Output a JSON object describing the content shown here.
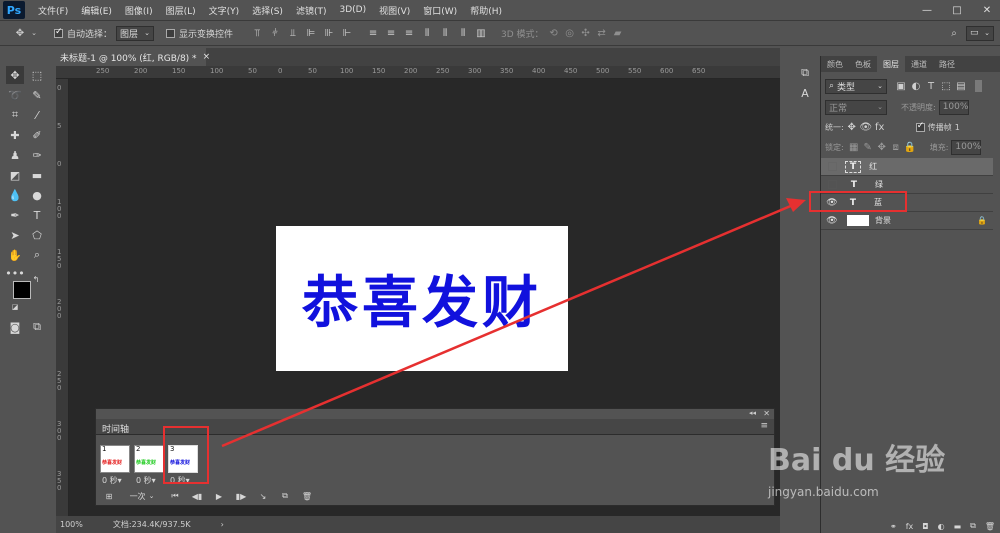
{
  "app": {
    "logo": "Ps"
  },
  "menu": [
    "文件(F)",
    "编辑(E)",
    "图像(I)",
    "图层(L)",
    "文字(Y)",
    "选择(S)",
    "滤镜(T)",
    "3D(D)",
    "视图(V)",
    "窗口(W)",
    "帮助(H)"
  ],
  "window_controls": {
    "minimize": "—",
    "maximize": "□",
    "close": "✕"
  },
  "options": {
    "auto_select_label": "自动选择：",
    "auto_select_value": "图层",
    "show_transform_label": "显示变换控件",
    "mode_3d_label": "3D 模式："
  },
  "document": {
    "tab_title": "未标题-1 @ 100% (红, RGB/8) *",
    "tab_close": "×",
    "canvas_text": "恭喜发财",
    "canvas_text_color": "#1111dd"
  },
  "ruler_top": [
    "250",
    "200",
    "150",
    "100",
    "50",
    "0",
    "50",
    "100",
    "150",
    "200",
    "250",
    "300",
    "350",
    "400",
    "450",
    "500",
    "550",
    "600",
    "650"
  ],
  "ruler_left": [
    "0",
    "5",
    "0",
    "1 0 0",
    "1 5 0",
    "2 0 0",
    "2 5 0",
    "3 0 0",
    "3 5 0"
  ],
  "timeline": {
    "title": "时间轴",
    "frames": [
      {
        "num": "1",
        "text": "恭喜发财",
        "text_color": "#e52222",
        "delay": "0 秒▾"
      },
      {
        "num": "2",
        "text": "恭喜发财",
        "text_color": "#22cc22",
        "delay": "0 秒▾"
      },
      {
        "num": "3",
        "text": "恭喜发财",
        "text_color": "#1111dd",
        "delay": "0 秒▾"
      }
    ],
    "loop_value": "一次"
  },
  "status": {
    "zoom": "100%",
    "doc_info": "文档:234.4K/937.5K"
  },
  "panel": {
    "tabs": [
      "颜色",
      "色板",
      "图层",
      "通道",
      "路径"
    ],
    "active_tab": "图层",
    "filter_kind": "类型",
    "blend_mode": "正常",
    "opacity_label": "不透明度:",
    "opacity_value": "100%",
    "unify_label": "统一:",
    "propagate_label": "传播帧",
    "propagate_value": "1",
    "lock_label": "锁定:",
    "fill_label": "填充:",
    "fill_value": "100%",
    "layers": [
      {
        "name": "红",
        "type": "text",
        "visible": false,
        "selected": true
      },
      {
        "name": "绿",
        "type": "text",
        "visible": false,
        "selected": false
      },
      {
        "name": "蓝",
        "type": "text",
        "visible": true,
        "selected": false
      },
      {
        "name": "背景",
        "type": "image",
        "visible": true,
        "selected": false,
        "locked": true
      }
    ]
  },
  "watermark": {
    "brand": "Bai du 经验",
    "url": "jingyan.baidu.com"
  },
  "colors": {
    "annotation_red": "#e63030",
    "arrow": "#e63030"
  }
}
